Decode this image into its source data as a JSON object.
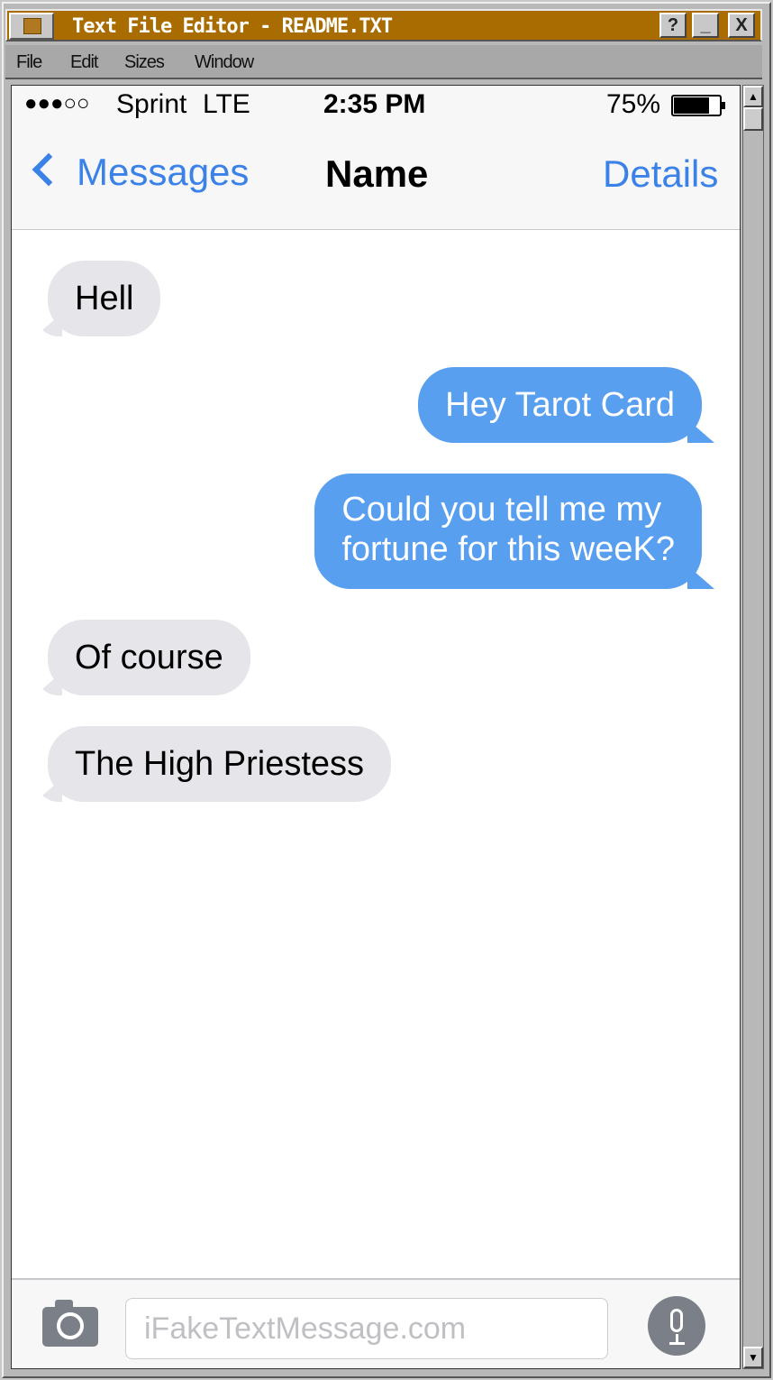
{
  "window": {
    "title": "Text File Editor - README.TXT",
    "buttons": {
      "help": "?",
      "minimize": "_",
      "close": "X"
    }
  },
  "menu": [
    "File",
    "Edit",
    "Sizes",
    "Window"
  ],
  "status": {
    "signal": "●●●○○",
    "carrier": "Sprint",
    "network": "LTE",
    "time": "2:35 PM",
    "battery": "75%",
    "battery_level": 0.75
  },
  "nav": {
    "back": "Messages",
    "title": "Name",
    "details": "Details"
  },
  "messages": [
    {
      "from": "them",
      "text": "Hell"
    },
    {
      "from": "me",
      "text": "Hey Tarot Card"
    },
    {
      "from": "me",
      "text": "Could you tell me my",
      "text2": "fortune for this weeK?"
    },
    {
      "from": "them",
      "text": "Of course"
    },
    {
      "from": "them",
      "text": "The High Priestess"
    }
  ],
  "compose": {
    "placeholder": "iFakeTextMessage.com"
  },
  "colors": {
    "title_bar": "#a86c00",
    "outgoing": "#589ff0",
    "incoming": "#e5e5ea",
    "accent": "#3b82e8"
  }
}
